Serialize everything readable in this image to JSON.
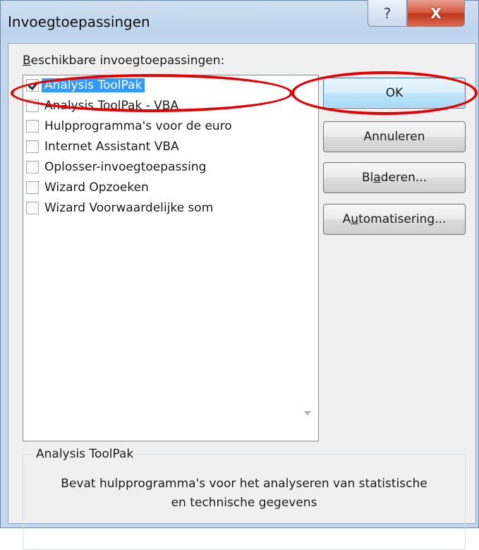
{
  "window": {
    "title": "Invoegtoepassingen",
    "help_glyph": "?",
    "close_glyph": "X"
  },
  "addins": {
    "label_access": "B",
    "label_rest": "eschikbare invoegtoepassingen:",
    "items": [
      {
        "label": "Analysis ToolPak",
        "checked": true,
        "selected": true
      },
      {
        "label": "Analysis ToolPak - VBA",
        "checked": false,
        "selected": false
      },
      {
        "label": "Hulpprogramma's voor de euro",
        "checked": false,
        "selected": false
      },
      {
        "label": "Internet Assistant VBA",
        "checked": false,
        "selected": false
      },
      {
        "label": "Oplosser-invoegtoepassing",
        "checked": false,
        "selected": false
      },
      {
        "label": "Wizard Opzoeken",
        "checked": false,
        "selected": false
      },
      {
        "label": "Wizard Voorwaardelijke som",
        "checked": false,
        "selected": false
      }
    ]
  },
  "buttons": {
    "ok": "OK",
    "cancel": "Annuleren",
    "browse_before": "Bl",
    "browse_access": "a",
    "browse_after": "deren...",
    "automation_before": "A",
    "automation_access": "u",
    "automation_after": "tomatisering..."
  },
  "details": {
    "title": "Analysis ToolPak",
    "description_line1": "Bevat hulpprogramma's voor het analyseren van statistische",
    "description_line2": "en technische gegevens"
  },
  "colors": {
    "selection": "#3399ff",
    "annotation": "#e60000"
  }
}
